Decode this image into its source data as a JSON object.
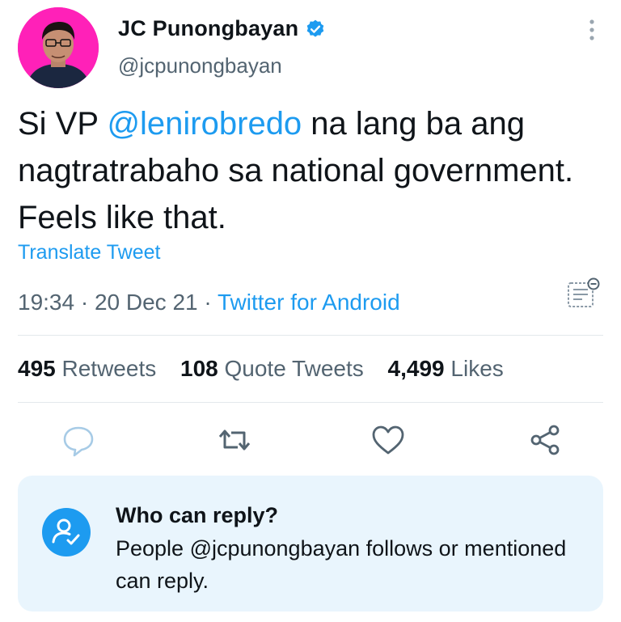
{
  "author": {
    "display_name": "JC Punongbayan",
    "handle": "@jcpunongbayan",
    "verified_icon": "verified-badge-icon"
  },
  "tweet": {
    "text_before": "Si VP ",
    "mention": "@lenirobredo",
    "text_after": " na lang ba ang nagtratrabaho sa national government. Feels like that.",
    "translate_label": "Translate Tweet",
    "time": "19:34",
    "date": "20 Dec 21",
    "separator": "·",
    "source": "Twitter for Android"
  },
  "stats": {
    "retweets_count": "495",
    "retweets_label": "Retweets",
    "quotes_count": "108",
    "quotes_label": "Quote Tweets",
    "likes_count": "4,499",
    "likes_label": "Likes"
  },
  "actions": [
    "reply-icon",
    "retweet-icon",
    "like-icon",
    "share-icon"
  ],
  "reply_settings": {
    "title": "Who can reply?",
    "body": "People @jcpunongbayan follows or mentioned can reply."
  },
  "colors": {
    "accent": "#1d9bf0",
    "text": "#0f1419",
    "secondary": "#536471",
    "panel": "#e9f5fd",
    "avatar_bg": "#ff21b8"
  }
}
